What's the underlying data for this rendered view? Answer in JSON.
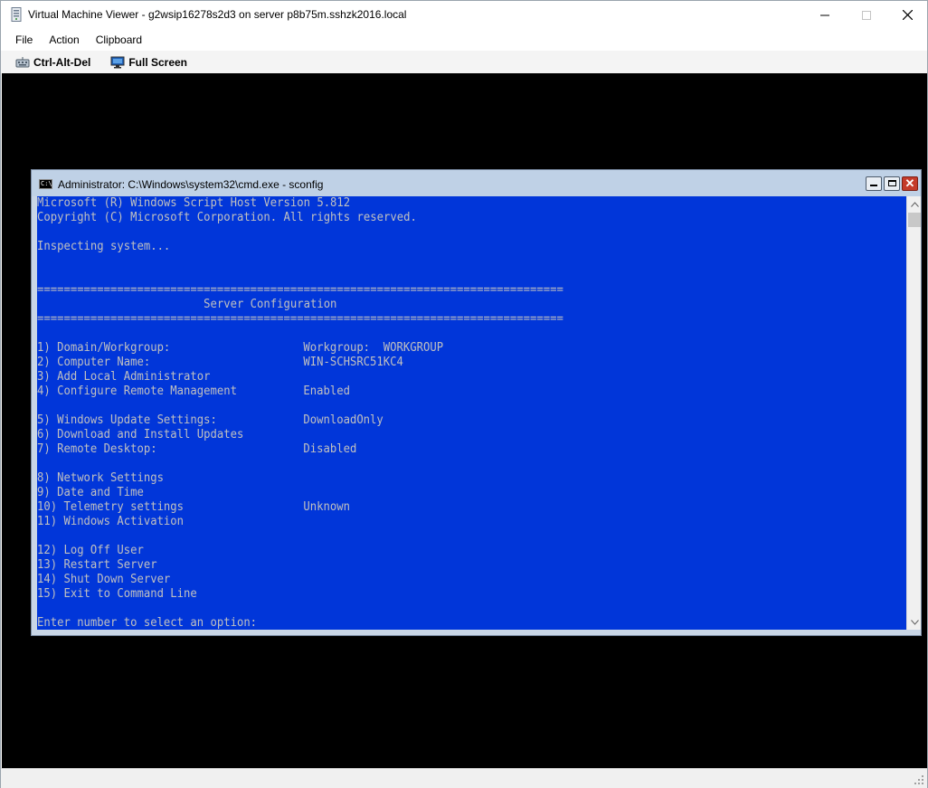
{
  "window": {
    "title": "Virtual Machine Viewer - g2wsip16278s2d3 on server p8b75m.sshzk2016.local"
  },
  "menu": {
    "items": [
      "File",
      "Action",
      "Clipboard"
    ]
  },
  "toolbar": {
    "ctrl_alt_del": "Ctrl-Alt-Del",
    "full_screen": "Full Screen"
  },
  "console": {
    "title": "Administrator: C:\\Windows\\system32\\cmd.exe - sconfig",
    "icon_text": "C:\\",
    "text_color": "#c0c0c0",
    "background": "#0136d9",
    "lines": [
      "Microsoft (R) Windows Script Host Version 5.812",
      "Copyright (C) Microsoft Corporation. All rights reserved.",
      "",
      "Inspecting system...",
      "",
      "",
      "===============================================================================",
      "                         Server Configuration",
      "===============================================================================",
      "",
      "1) Domain/Workgroup:",
      "2) Computer Name:",
      "3) Add Local Administrator",
      "4) Configure Remote Management",
      "",
      "5) Windows Update Settings:",
      "6) Download and Install Updates",
      "7) Remote Desktop:",
      "",
      "8) Network Settings",
      "9) Date and Time",
      "10) Telemetry settings",
      "11) Windows Activation",
      "",
      "12) Log Off User",
      "13) Restart Server",
      "14) Shut Down Server",
      "15) Exit to Command Line",
      "",
      "Enter number to select an option:"
    ],
    "values": {
      "domain": "Workgroup:  WORKGROUP",
      "computer_name": "WIN-SCHSRC51KC4",
      "remote_management": "Enabled",
      "windows_update": "DownloadOnly",
      "remote_desktop": "Disabled",
      "telemetry": "Unknown"
    }
  }
}
